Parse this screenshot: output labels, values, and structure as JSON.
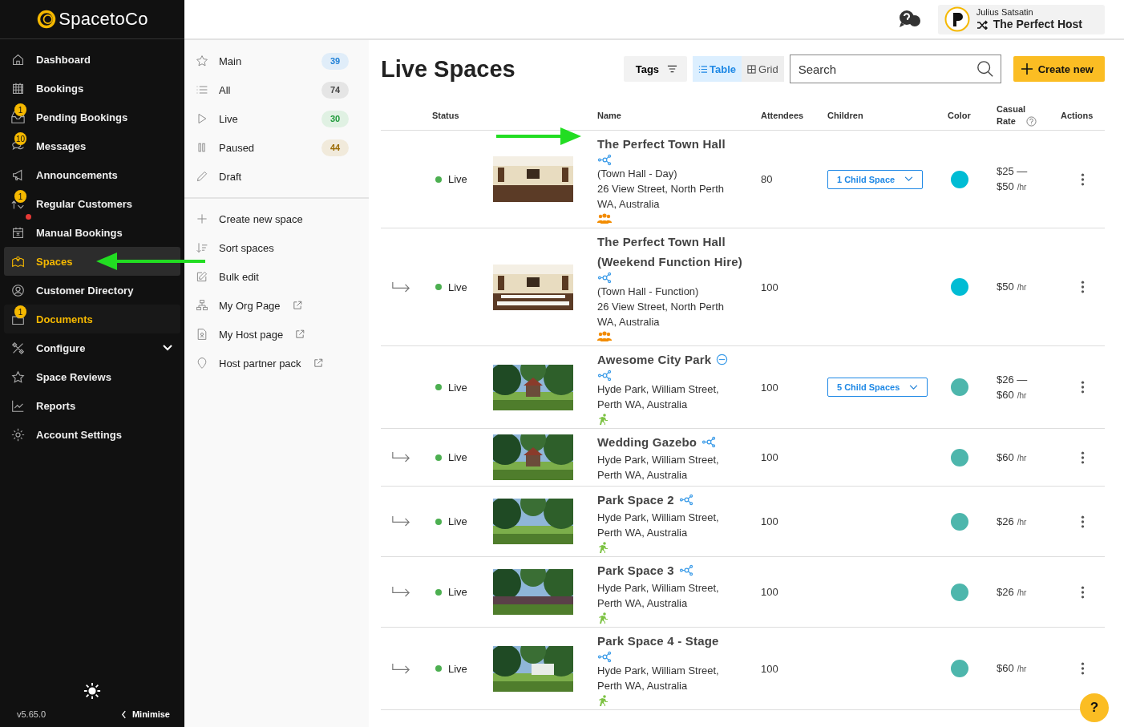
{
  "logo": "SpacetoCo",
  "nav": [
    {
      "label": "Dashboard",
      "selected": false
    },
    {
      "label": "Bookings",
      "selected": false
    },
    {
      "label": "Pending Bookings",
      "selected": false,
      "badge": "1"
    },
    {
      "label": "Messages",
      "selected": false,
      "badge": "10"
    },
    {
      "label": "Announcements",
      "selected": false
    },
    {
      "label": "Regular Customers",
      "selected": false,
      "badge": "1",
      "alert": true
    },
    {
      "label": "Manual Bookings",
      "selected": false
    },
    {
      "label": "Spaces",
      "selected": true
    },
    {
      "label": "Customer Directory",
      "selected": false
    },
    {
      "label": "Documents",
      "selected": false,
      "badge": "1",
      "highlighted": true
    },
    {
      "label": "Configure",
      "selected": false,
      "expandable": true
    },
    {
      "label": "Space Reviews",
      "selected": false
    },
    {
      "label": "Reports",
      "selected": false
    },
    {
      "label": "Account Settings",
      "selected": false
    }
  ],
  "version": "v5.65.0",
  "minimise": "Minimise",
  "filters": [
    {
      "label": "Main",
      "count": "39",
      "color": "#1e7fd6"
    },
    {
      "label": "All",
      "count": "74",
      "color": "#444444"
    },
    {
      "label": "Live",
      "count": "30",
      "color": "#1f9a3a"
    },
    {
      "label": "Paused",
      "count": "44",
      "color": "#9a6a00"
    },
    {
      "label": "Draft"
    }
  ],
  "actions": [
    {
      "label": "Create new space",
      "external": false
    },
    {
      "label": "Sort spaces",
      "external": false
    },
    {
      "label": "Bulk edit",
      "external": false
    },
    {
      "label": "My Org Page",
      "external": true
    },
    {
      "label": "My Host page",
      "external": true
    },
    {
      "label": "Host partner pack",
      "external": true
    }
  ],
  "account": {
    "name": "Julius Satsatin",
    "org": "The Perfect Host"
  },
  "title": "Live Spaces",
  "tags_button": "Tags",
  "views": [
    {
      "label": "Table",
      "selected": true
    },
    {
      "label": "Grid",
      "selected": false
    }
  ],
  "search": {
    "placeholder": "Search"
  },
  "create_button": "Create new",
  "columns": [
    "Status",
    "Name",
    "Attendees",
    "Children",
    "Color",
    "Casual Rate",
    "Actions"
  ],
  "rows": [
    {
      "child": false,
      "status": "Live",
      "name": "The Perfect Town Hall",
      "icon_inline": false,
      "extra_icon": false,
      "details": [
        "(Town Hall - Day)",
        "26 View Street, North Perth WA, Australia"
      ],
      "amenity": {
        "kind": "group"
      },
      "attendees": "80",
      "children": "1 Child Space",
      "color": "#00bcd4",
      "rate": [
        "$25 —",
        "$50"
      ],
      "unit": "/hr",
      "photo": {
        "kind": "picture"
      }
    },
    {
      "child": true,
      "status": "Live",
      "name": "The Perfect Town Hall (Weekend Function Hire)",
      "icon_inline": false,
      "extra_icon": false,
      "details": [
        "(Town Hall - Function)",
        "26 View Street, North Perth WA, Australia"
      ],
      "amenity": {
        "kind": "group"
      },
      "attendees": "100",
      "color": "#00bcd4",
      "rate": [
        "$50"
      ],
      "unit": "/hr",
      "photo": {
        "kind": "picture"
      }
    },
    {
      "child": false,
      "status": "Live",
      "name": "Awesome City Park",
      "icon_inline": false,
      "extra_icon": true,
      "details": [
        "Hyde Park, William Street, Perth WA, Australia"
      ],
      "amenity": {
        "kind": "runner"
      },
      "attendees": "100",
      "children": "5 Child Spaces",
      "color": "#4db6ac",
      "rate": [
        "$26 —",
        "$60"
      ],
      "unit": "/hr",
      "photo": {
        "kind": "picture"
      }
    },
    {
      "child": true,
      "status": "Live",
      "name": "Wedding Gazebo",
      "icon_inline": true,
      "extra_icon": false,
      "details": [
        "Hyde Park, William Street, Perth WA, Australia"
      ],
      "attendees": "100",
      "color": "#4db6ac",
      "rate": [
        "$60"
      ],
      "unit": "/hr",
      "photo": {
        "kind": "picture"
      }
    },
    {
      "child": true,
      "status": "Live",
      "name": "Park Space 2",
      "icon_inline": true,
      "extra_icon": false,
      "details": [
        "Hyde Park, William Street, Perth WA, Australia"
      ],
      "amenity": {
        "kind": "runner"
      },
      "attendees": "100",
      "color": "#4db6ac",
      "rate": [
        "$26"
      ],
      "unit": "/hr",
      "photo": {
        "kind": "picture"
      }
    },
    {
      "child": true,
      "status": "Live",
      "name": "Park Space 3",
      "icon_inline": true,
      "extra_icon": false,
      "details": [
        "Hyde Park, William Street, Perth WA, Australia"
      ],
      "amenity": {
        "kind": "runner"
      },
      "attendees": "100",
      "color": "#4db6ac",
      "rate": [
        "$26"
      ],
      "unit": "/hr",
      "photo": {
        "kind": "picture"
      }
    },
    {
      "child": true,
      "status": "Live",
      "name": "Park Space 4 - Stage",
      "icon_inline": false,
      "extra_icon": false,
      "details": [
        "Hyde Park, William Street, Perth WA, Australia"
      ],
      "amenity": {
        "kind": "runner"
      },
      "attendees": "100",
      "color": "#4db6ac",
      "rate": [
        "$60"
      ],
      "unit": "/hr",
      "photo": {
        "kind": "picture"
      }
    }
  ],
  "help": "?"
}
